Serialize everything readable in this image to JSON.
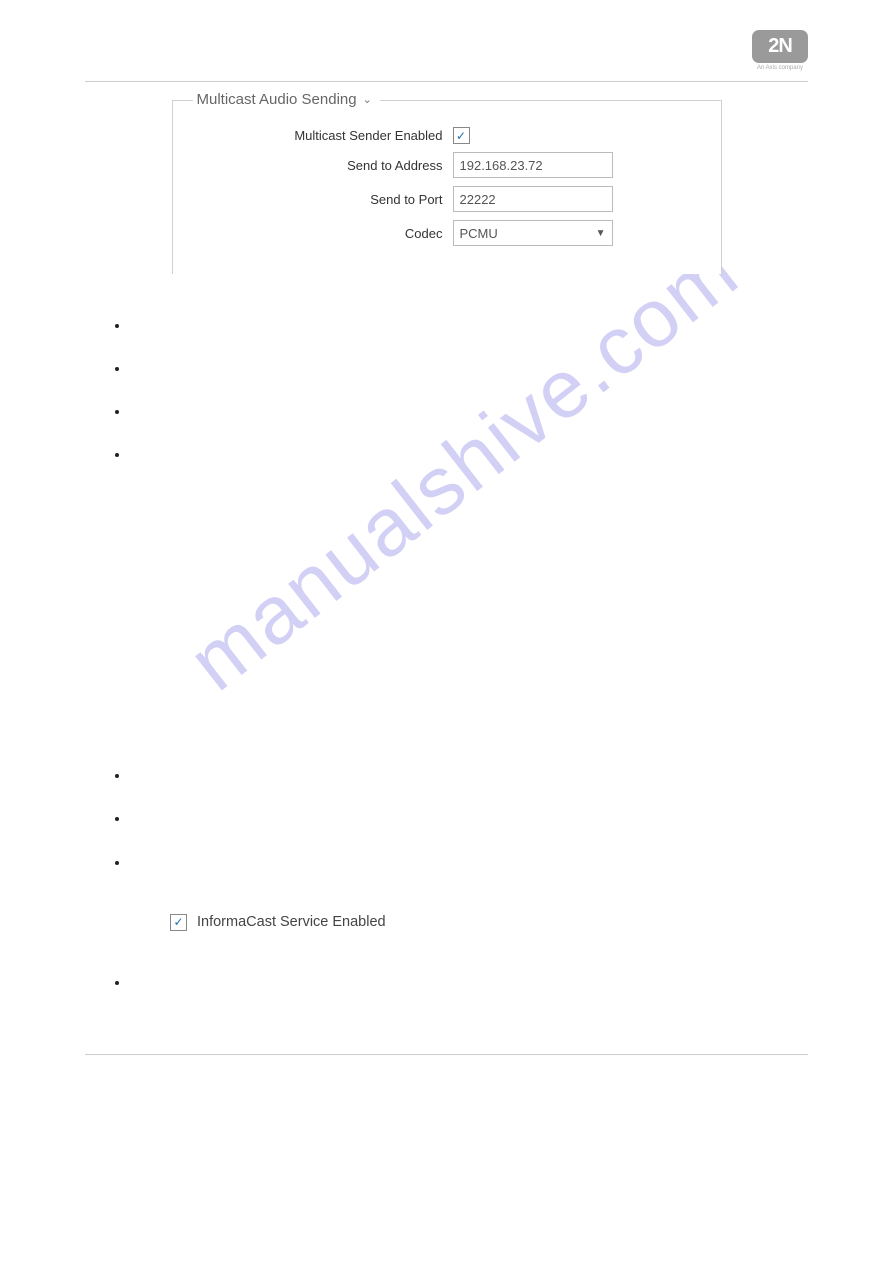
{
  "logo": {
    "text": "2N",
    "subtitle": "An Axis company"
  },
  "watermark": "manualshive.com",
  "fieldset": {
    "legend": "Multicast Audio Sending",
    "rows": {
      "enabled": {
        "label": "Multicast Sender Enabled",
        "checked": true
      },
      "address": {
        "label": "Send to Address",
        "value": "192.168.23.72"
      },
      "port": {
        "label": "Send to Port",
        "value": "22222"
      },
      "codec": {
        "label": "Codec",
        "value": "PCMU"
      }
    }
  },
  "bullets_top": [
    "",
    "",
    "",
    ""
  ],
  "bullets_mid": [
    "",
    "",
    ""
  ],
  "informacast": {
    "label": "InformaCast Service Enabled",
    "checked": true
  },
  "bullets_bottom": [
    ""
  ]
}
